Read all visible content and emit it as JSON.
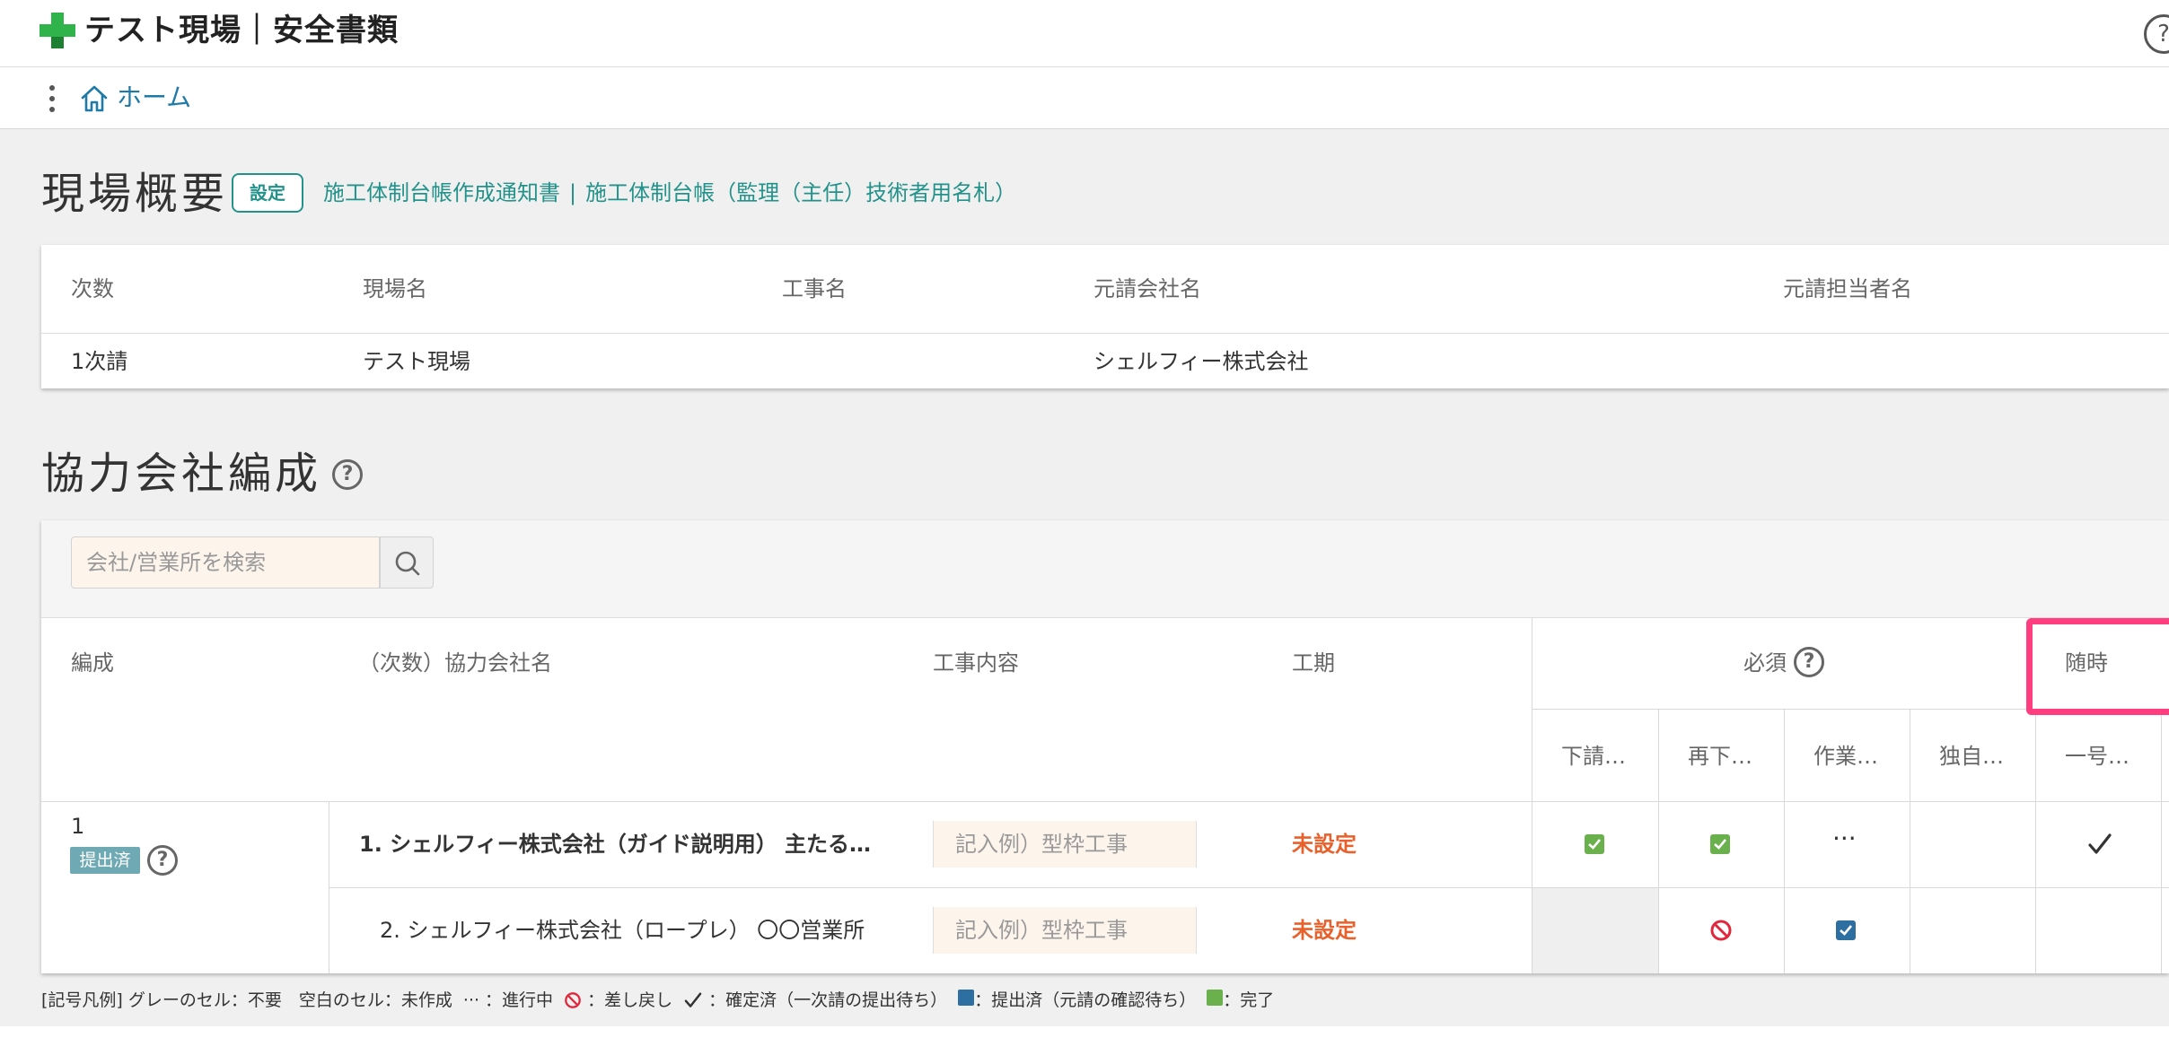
{
  "header": {
    "title": "テスト現場｜安全書類",
    "help": "?"
  },
  "nav": {
    "home_label": "ホーム"
  },
  "overview": {
    "title": "現場概要",
    "settings_label": "設定",
    "link1": "施工体制台帳作成通知書",
    "link_sep": "|",
    "link2": "施工体制台帳（監理（主任）技術者用名札）",
    "columns": [
      "次数",
      "現場名",
      "工事名",
      "元請会社名",
      "元請担当者名"
    ],
    "row": [
      "1次請",
      "テスト現場",
      "",
      "シェルフィー株式会社",
      ""
    ]
  },
  "partners": {
    "title": "協力会社編成",
    "help": "?",
    "search_placeholder": "会社/営業所を検索",
    "columns": {
      "composition": "編成",
      "company": "（次数）協力会社名",
      "content": "工事内容",
      "period": "工期",
      "required": "必須",
      "anytime": "随時"
    },
    "sub_columns": [
      "下請…",
      "再下…",
      "作業…",
      "独自…",
      "一号…"
    ],
    "group": {
      "number": "1",
      "status": "提出済",
      "help": "?"
    },
    "rows": [
      {
        "company": "1. シェルフィー株式会社（ガイド説明用） 主たる…",
        "content_placeholder": "記入例）型枠工事",
        "period": "未設定",
        "dots": "···"
      },
      {
        "company": "2. シェルフィー株式会社（ロープレ） 〇〇営業所",
        "content_placeholder": "記入例）型枠工事",
        "period": "未設定"
      }
    ]
  },
  "legend": {
    "prefix": "[記号凡例] グレーのセル：不要　空白のセル：未作成",
    "dots": "···",
    "in_progress": "：進行中",
    "returned": "：差し戻し",
    "confirmed": "：確定済（一次請の提出待ち）",
    "submitted": "：提出済（元請の確認待ち）",
    "complete": "：完了"
  },
  "colors": {
    "accent": "#23928a",
    "link": "#1f7aa8",
    "warning": "#e8612c",
    "complete_green": "#6ab04c",
    "submitted_blue": "#2d6fa0",
    "highlight": "#ff3d7f"
  }
}
